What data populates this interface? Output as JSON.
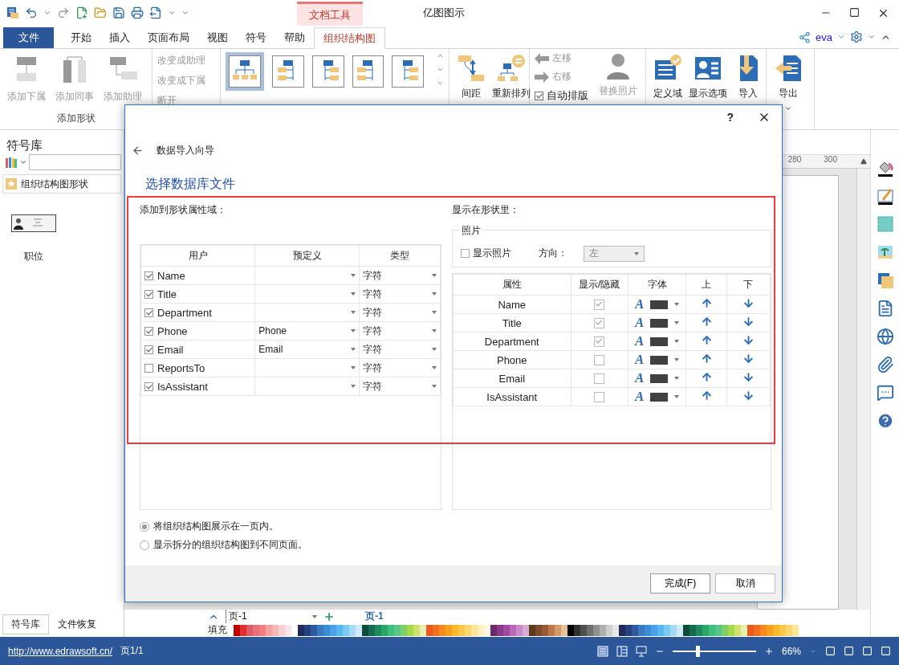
{
  "app": {
    "title": "亿图图示",
    "context_tab": "文档工具",
    "user": "eva"
  },
  "menu_tabs": [
    {
      "label": "文件",
      "kind": "file",
      "selected": false
    },
    {
      "label": "开始",
      "kind": "tab",
      "selected": false
    },
    {
      "label": "插入",
      "kind": "tab",
      "selected": false
    },
    {
      "label": "页面布局",
      "kind": "tab",
      "selected": false
    },
    {
      "label": "视图",
      "kind": "tab",
      "selected": false
    },
    {
      "label": "符号",
      "kind": "tab",
      "selected": false
    },
    {
      "label": "帮助",
      "kind": "tab",
      "selected": false
    },
    {
      "label": "组织结构图",
      "kind": "tab",
      "selected": true
    }
  ],
  "ribbon": {
    "add_shape": {
      "group_label": "添加形状",
      "buttons": [
        {
          "label": "添加下属",
          "disabled": true
        },
        {
          "label": "添加同事",
          "disabled": true
        },
        {
          "label": "添加助理",
          "disabled": true
        }
      ]
    },
    "change": [
      {
        "label": "改变成助理",
        "disabled": true
      },
      {
        "label": "改变成下属",
        "disabled": true
      },
      {
        "label": "断开",
        "disabled": true
      }
    ],
    "layouts": [
      {
        "selected": true
      },
      {
        "selected": false
      },
      {
        "selected": false
      },
      {
        "selected": false
      },
      {
        "selected": false
      }
    ],
    "arrange": [
      {
        "label": "间距"
      },
      {
        "label": "重新排列"
      }
    ],
    "move": [
      {
        "label": "左移",
        "disabled": true
      },
      {
        "label": "右移",
        "disabled": true
      }
    ],
    "auto_layout": {
      "label": "自动排版",
      "checked": true
    },
    "replace_photo": {
      "label": "替换照片",
      "disabled": true
    },
    "data": [
      {
        "label": "定义域"
      },
      {
        "label": "显示选项"
      },
      {
        "label": "导入"
      }
    ],
    "export": {
      "label": "导出"
    }
  },
  "library": {
    "title": "符号库",
    "category": "组织结构图形状",
    "shape_label": "职位"
  },
  "bottom_tabs": [
    {
      "label": "符号库",
      "selected": true
    },
    {
      "label": "文件恢复",
      "selected": false
    }
  ],
  "ruler": [
    "280",
    "300"
  ],
  "page_bar": {
    "page_select": "页-1",
    "page_tab": "页-1",
    "fill_label": "填充"
  },
  "status_bar": {
    "url": "http://www.edrawsoft.cn/",
    "page": "页1/1",
    "zoom": "66%",
    "zoom_slider": {
      "level": 0.3
    }
  },
  "dialog": {
    "help": "?",
    "wizard_title": "数据导入向导",
    "heading": "选择数据库文件",
    "fields": {
      "label": "添加到形状属性域：",
      "columns": [
        "用户",
        "预定义",
        "类型"
      ],
      "rows": [
        {
          "name": "Name",
          "checked": true,
          "predefined": "",
          "type": "字符"
        },
        {
          "name": "Title",
          "checked": true,
          "predefined": "",
          "type": "字符"
        },
        {
          "name": "Department",
          "checked": true,
          "predefined": "",
          "type": "字符"
        },
        {
          "name": "Phone",
          "checked": true,
          "predefined": "Phone",
          "type": "字符"
        },
        {
          "name": "Email",
          "checked": true,
          "predefined": "Email",
          "type": "字符"
        },
        {
          "name": "ReportsTo",
          "checked": false,
          "predefined": "",
          "type": "字符"
        },
        {
          "name": "IsAssistant",
          "checked": true,
          "predefined": "",
          "type": "字符"
        }
      ]
    },
    "display": {
      "label": "显示在形状里：",
      "photo": {
        "title": "照片",
        "show_photo": {
          "label": "显示照片",
          "checked": false
        },
        "direction_label": "方向：",
        "direction": "左"
      },
      "columns": [
        "属性",
        "显示/隐藏",
        "字体",
        "上",
        "下"
      ],
      "rows": [
        {
          "name": "Name",
          "visible": true,
          "font": "A",
          "color": "#404040"
        },
        {
          "name": "Title",
          "visible": true,
          "font": "A",
          "color": "#404040"
        },
        {
          "name": "Department",
          "visible": true,
          "font": "A",
          "color": "#404040"
        },
        {
          "name": "Phone",
          "visible": false,
          "font": "A",
          "color": "#404040"
        },
        {
          "name": "Email",
          "visible": false,
          "font": "A",
          "color": "#404040"
        },
        {
          "name": "IsAssistant",
          "visible": false,
          "font": "A",
          "color": "#404040"
        }
      ]
    },
    "page_options": [
      {
        "label": "将组织结构图展示在一页内。",
        "selected": true
      },
      {
        "label": "显示拆分的组织结构图到不同页面。",
        "selected": false
      }
    ],
    "buttons": [
      {
        "label": "完成(F)",
        "kind": "primary"
      },
      {
        "label": "取消",
        "kind": "cancel"
      }
    ]
  }
}
